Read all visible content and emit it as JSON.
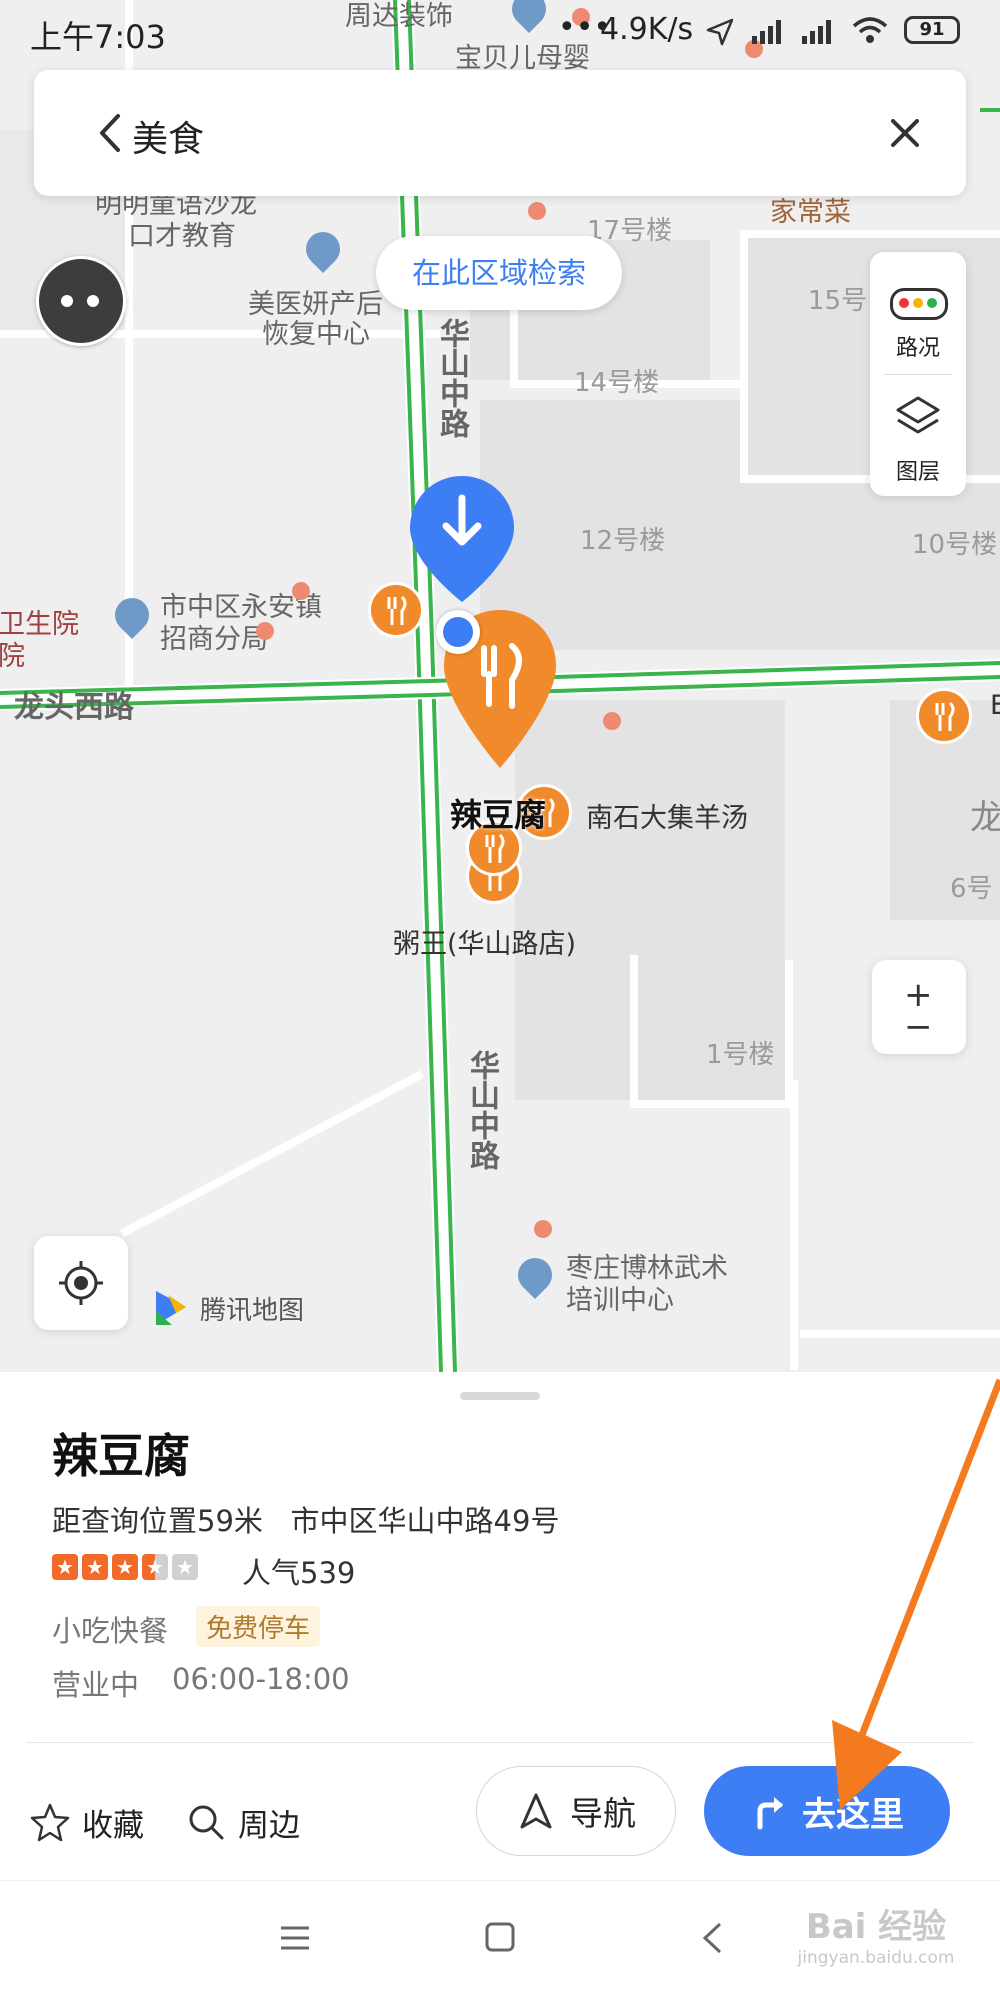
{
  "status": {
    "time": "上午7:03",
    "speed": "4.9K/s",
    "battery": "91"
  },
  "search": {
    "query": "美食"
  },
  "map": {
    "area_search_label": "在此区域检索",
    "road_status_label": "路况",
    "layers_label": "图层",
    "attribution": "腾讯地图",
    "labels": {
      "zhoudazhuangshi": "周达装饰",
      "baobeimuying": "宝贝儿母婴",
      "mingming_1": "明明童语沙龙",
      "mingming_2": "口才教育",
      "jiachangcai": "家常菜",
      "bld17": "17号楼",
      "bld15": "15号",
      "bld14": "14号楼",
      "bld12": "12号楼",
      "bld10": "10号楼",
      "bld6": "6号",
      "bld1": "1号楼",
      "meiyi_1": "美医妍产后",
      "meiyi_2": "恢复中心",
      "weishengyuan_1": "卫生院",
      "weishengyuan_2": "院",
      "yongan_1": "市中区永安镇",
      "yongan_2": "招商分局",
      "longtouxilu": "龙头西路",
      "huashan_top": "华山中路",
      "huashan_bottom": "华山中路",
      "ladoufu": "辣豆腐",
      "nanshi": "南石大集羊汤",
      "zhouwang": "粥王(华山路店)",
      "bolin_1": "枣庄博林武术",
      "bolin_2": "培训中心",
      "long": "龙",
      "e": "E"
    }
  },
  "place": {
    "name": "辣豆腐",
    "distance_address": "距查询位置59米   市中区华山中路49号",
    "rating": 3.5,
    "popularity": "人气539",
    "category": "小吃快餐",
    "tag": "免费停车",
    "hours_status": "营业中",
    "hours": "06:00-18:00"
  },
  "actions": {
    "favorite": "收藏",
    "nearby": "周边",
    "navigate": "导航",
    "go_here": "去这里"
  },
  "watermark": {
    "brand": "Bai 经验",
    "url": "jingyan.baidu.com"
  },
  "colors": {
    "accent": "#3e7ef5",
    "poi": "#f08a2a",
    "road_green": "#39b54a",
    "tag_bg": "#fdf3df",
    "tag_fg": "#b07a2a",
    "arrow": "#f47a20"
  }
}
